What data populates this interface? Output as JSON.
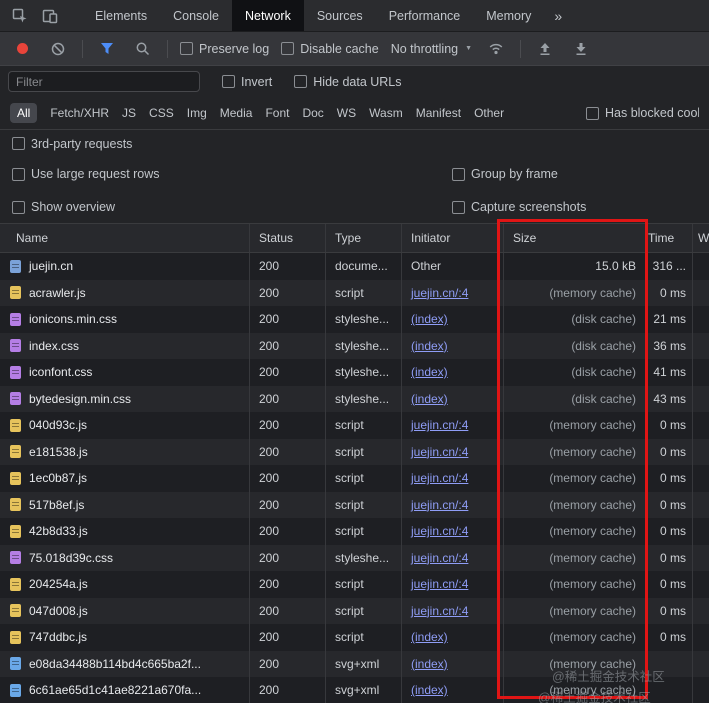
{
  "tabbar": {
    "tabs": [
      "Elements",
      "Console",
      "Network",
      "Sources",
      "Performance",
      "Memory"
    ],
    "selected": "Network",
    "more": "»"
  },
  "toolbar": {
    "preserve_log": "Preserve log",
    "disable_cache": "Disable cache",
    "throttling": "No throttling"
  },
  "filter_bar": {
    "placeholder": "Filter",
    "invert": "Invert",
    "hide_data_urls": "Hide data URLs"
  },
  "filters": {
    "pills": [
      "All",
      "Fetch/XHR",
      "JS",
      "CSS",
      "Img",
      "Media",
      "Font",
      "Doc",
      "WS",
      "Wasm",
      "Manifest",
      "Other"
    ],
    "selected": "All",
    "has_blocked_cookies": "Has blocked cookies"
  },
  "options": {
    "third_party": "3rd-party requests",
    "use_large_rows": "Use large request rows",
    "group_by_frame": "Group by frame",
    "show_overview": "Show overview",
    "capture_screenshots": "Capture screenshots"
  },
  "table": {
    "columns": [
      "Name",
      "Status",
      "Type",
      "Initiator",
      "Size",
      "Time",
      "W"
    ],
    "rows": [
      {
        "icon": "document",
        "name": "juejin.cn",
        "status": "200",
        "type": "docume...",
        "initiator": "Other",
        "initiator_link": false,
        "size": "15.0 kB",
        "time": "316 ..."
      },
      {
        "icon": "script",
        "name": "acrawler.js",
        "status": "200",
        "type": "script",
        "initiator": "juejin.cn/:4",
        "initiator_link": true,
        "size": "(memory cache)",
        "time": "0 ms"
      },
      {
        "icon": "stylesheet",
        "name": "ionicons.min.css",
        "status": "200",
        "type": "styleshe...",
        "initiator": "(index)",
        "initiator_link": true,
        "size": "(disk cache)",
        "time": "21 ms"
      },
      {
        "icon": "stylesheet",
        "name": "index.css",
        "status": "200",
        "type": "styleshe...",
        "initiator": "(index)",
        "initiator_link": true,
        "size": "(disk cache)",
        "time": "36 ms"
      },
      {
        "icon": "stylesheet",
        "name": "iconfont.css",
        "status": "200",
        "type": "styleshe...",
        "initiator": "(index)",
        "initiator_link": true,
        "size": "(disk cache)",
        "time": "41 ms"
      },
      {
        "icon": "stylesheet",
        "name": "bytedesign.min.css",
        "status": "200",
        "type": "styleshe...",
        "initiator": "(index)",
        "initiator_link": true,
        "size": "(disk cache)",
        "time": "43 ms"
      },
      {
        "icon": "script",
        "name": "040d93c.js",
        "status": "200",
        "type": "script",
        "initiator": "juejin.cn/:4",
        "initiator_link": true,
        "size": "(memory cache)",
        "time": "0 ms"
      },
      {
        "icon": "script",
        "name": "e181538.js",
        "status": "200",
        "type": "script",
        "initiator": "juejin.cn/:4",
        "initiator_link": true,
        "size": "(memory cache)",
        "time": "0 ms"
      },
      {
        "icon": "script",
        "name": "1ec0b87.js",
        "status": "200",
        "type": "script",
        "initiator": "juejin.cn/:4",
        "initiator_link": true,
        "size": "(memory cache)",
        "time": "0 ms"
      },
      {
        "icon": "script",
        "name": "517b8ef.js",
        "status": "200",
        "type": "script",
        "initiator": "juejin.cn/:4",
        "initiator_link": true,
        "size": "(memory cache)",
        "time": "0 ms"
      },
      {
        "icon": "script",
        "name": "42b8d33.js",
        "status": "200",
        "type": "script",
        "initiator": "juejin.cn/:4",
        "initiator_link": true,
        "size": "(memory cache)",
        "time": "0 ms"
      },
      {
        "icon": "stylesheet",
        "name": "75.018d39c.css",
        "status": "200",
        "type": "styleshe...",
        "initiator": "juejin.cn/:4",
        "initiator_link": true,
        "size": "(memory cache)",
        "time": "0 ms"
      },
      {
        "icon": "script",
        "name": "204254a.js",
        "status": "200",
        "type": "script",
        "initiator": "juejin.cn/:4",
        "initiator_link": true,
        "size": "(memory cache)",
        "time": "0 ms"
      },
      {
        "icon": "script",
        "name": "047d008.js",
        "status": "200",
        "type": "script",
        "initiator": "juejin.cn/:4",
        "initiator_link": true,
        "size": "(memory cache)",
        "time": "0 ms"
      },
      {
        "icon": "script",
        "name": "747ddbc.js",
        "status": "200",
        "type": "script",
        "initiator": "(index)",
        "initiator_link": true,
        "size": "(memory cache)",
        "time": "0 ms"
      },
      {
        "icon": "image",
        "name": "e08da34488b114bd4c665ba2f...",
        "status": "200",
        "type": "svg+xml",
        "initiator": "(index)",
        "initiator_link": true,
        "size": "(memory cache)",
        "time": ""
      },
      {
        "icon": "image",
        "name": "6c61ae65d1c41ae8221a670fa...",
        "status": "200",
        "type": "svg+xml",
        "initiator": "(index)",
        "initiator_link": true,
        "size": "(memory cache)",
        "time": ""
      }
    ]
  },
  "icons": {
    "inspect": "element-picker",
    "device": "device-toolbar",
    "record": "record-dot",
    "clear": "circle-slash",
    "filter": "funnel",
    "search": "magnifier",
    "network_conditions": "signal-waves",
    "upload": "arrow-up",
    "download": "arrow-down"
  },
  "watermark": "@稀土掘金技术社区",
  "colors": {
    "accent_blue": "#4d8df7",
    "record_red": "#e8443a",
    "annotation_red": "#e01515",
    "link": "#8f9df6",
    "file_doc": "#7ba2d8",
    "file_script": "#e6c35c",
    "file_css": "#b57ee5",
    "file_img": "#6aa8e8"
  }
}
